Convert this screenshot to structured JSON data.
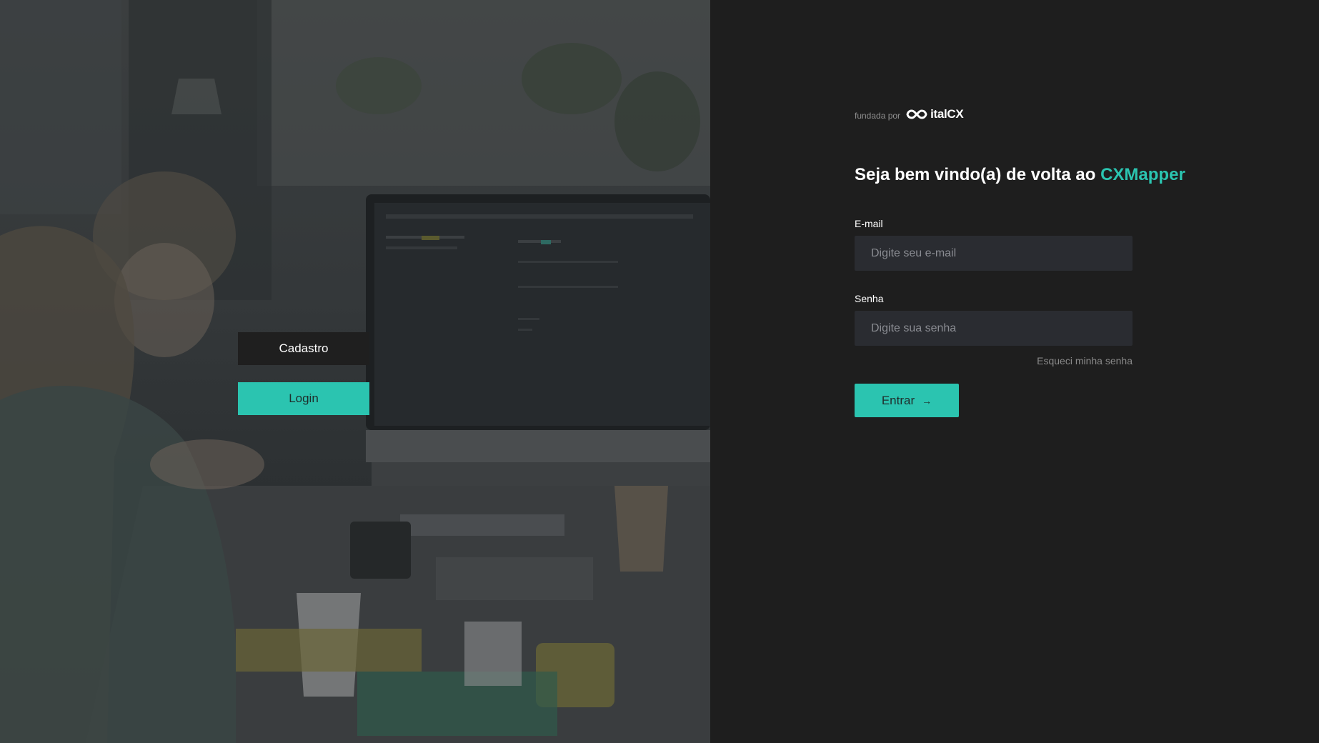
{
  "nav": {
    "cadastro_label": "Cadastro",
    "login_label": "Login"
  },
  "brand": {
    "prefix": "fundada por",
    "logo_text": "italCX",
    "logo_icon": "infinity-icon"
  },
  "form": {
    "welcome_prefix": "Seja bem vindo(a) de volta ao ",
    "welcome_accent": "CXMapper",
    "email_label": "E-mail",
    "email_placeholder": "Digite seu e-mail",
    "email_value": "",
    "password_label": "Senha",
    "password_placeholder": "Digite sua senha",
    "password_value": "",
    "forgot_label": "Esqueci minha senha",
    "submit_label": "Entrar",
    "submit_icon": "arrow-right-icon"
  },
  "colors": {
    "accent": "#2bc4b0",
    "panel_bg": "#1e1e1e",
    "input_bg": "#2a2c31",
    "dark_button": "#1f1f1f"
  }
}
